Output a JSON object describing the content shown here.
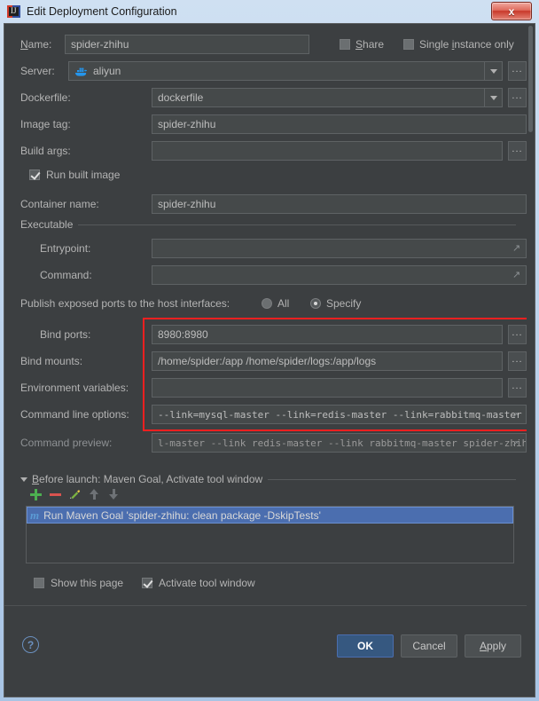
{
  "window": {
    "title": "Edit Deployment Configuration",
    "title_icon": "intellij-idea-icon",
    "close_label": "x"
  },
  "form": {
    "name": {
      "label": "Name:",
      "label_mnemonic": "N",
      "value": "spider-zhihu"
    },
    "share": {
      "label": "Share",
      "checked": false
    },
    "single_instance": {
      "label": "Single instance only",
      "checked": false
    },
    "server": {
      "label": "Server:",
      "value": "aliyun",
      "icon": "docker-whale-icon",
      "browse_label": "..."
    },
    "dockerfile": {
      "label": "Dockerfile:",
      "value": "dockerfile",
      "browse_label": "..."
    },
    "image_tag": {
      "label": "Image tag:",
      "value": "spider-zhihu"
    },
    "build_args": {
      "label": "Build args:",
      "value": "",
      "browse_label": "..."
    },
    "run_built_image": {
      "label": "Run built image",
      "checked": true
    },
    "container_name": {
      "label": "Container name:",
      "value": "spider-zhihu"
    },
    "executable_group": {
      "label": "Executable"
    },
    "entrypoint": {
      "label": "Entrypoint:",
      "value": "",
      "expand_icon": "expand-icon"
    },
    "command": {
      "label": "Command:",
      "value": "",
      "expand_icon": "expand-icon"
    },
    "publish_ports": {
      "label": "Publish exposed ports to the host interfaces:",
      "options": [
        {
          "label": "All",
          "selected": false
        },
        {
          "label": "Specify",
          "selected": true
        }
      ]
    },
    "bind_ports": {
      "label": "Bind ports:",
      "value": "8980:8980",
      "browse_label": "..."
    },
    "bind_mounts": {
      "label": "Bind mounts:",
      "value": "/home/spider:/app  /home/spider/logs:/app/logs",
      "browse_label": "..."
    },
    "environment_variables": {
      "label": "Environment variables:",
      "value": "",
      "browse_label": "..."
    },
    "command_line_options": {
      "label": "Command line options:",
      "value": "--link=mysql-master --link=redis-master --link=rabbitmq-master",
      "expand_icon": "expand-icon"
    },
    "command_preview": {
      "label": "Command preview:",
      "value": "l-master --link redis-master --link rabbitmq-master spider-zhihu",
      "expand_icon": "expand-icon"
    }
  },
  "annotation": {
    "highlight_color": "#f02020"
  },
  "before_launch": {
    "header": "Before launch: Maven Goal, Activate tool window",
    "header_mnemonic": "B",
    "collapse_icon": "triangle-down-icon",
    "toolbar": [
      {
        "name": "add-icon",
        "label": "+"
      },
      {
        "name": "remove-icon",
        "label": "−"
      },
      {
        "name": "edit-pencil-icon",
        "label": "✎"
      },
      {
        "name": "move-up-icon",
        "label": "↑"
      },
      {
        "name": "move-down-icon",
        "label": "↓"
      }
    ],
    "tasks": [
      {
        "icon": "maven-icon",
        "icon_letter": "m",
        "label": "Run Maven Goal 'spider-zhihu: clean package -DskipTests'",
        "selected": true
      }
    ]
  },
  "footer": {
    "show_this_page": {
      "label": "Show this page",
      "checked": false
    },
    "activate_tool_window": {
      "label": "Activate tool window",
      "checked": true
    },
    "help_label": "?",
    "buttons": {
      "ok": "OK",
      "cancel": "Cancel",
      "apply_pre": "A",
      "apply_post": "pply"
    }
  }
}
